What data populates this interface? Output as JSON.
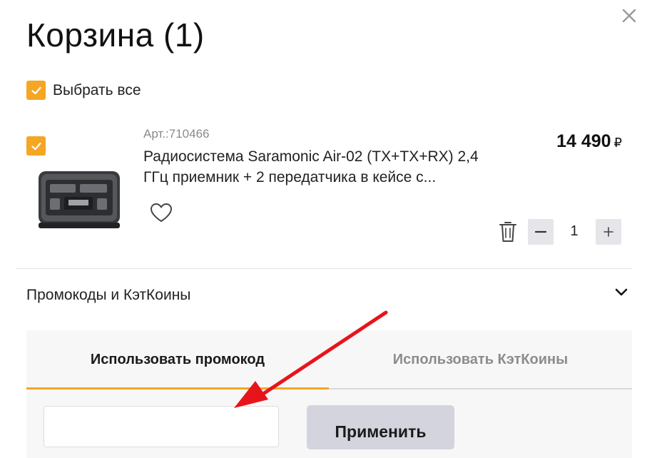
{
  "cart": {
    "title": "Корзина (1)",
    "select_all_label": "Выбрать все",
    "close_icon": "close-icon"
  },
  "item": {
    "article": "Арт.:710466",
    "name": "Радиосистема Saramonic Air-02 (TX+TX+RX) 2,4 ГГц приемник + 2 передатчика в кейсе с...",
    "price": "14 490",
    "currency": "₽",
    "quantity": "1",
    "selected": true
  },
  "promo": {
    "header": "Промокоды и КэтКоины",
    "tabs": [
      {
        "label": "Использовать  промокод",
        "active": true
      },
      {
        "label": "Использовать  КэтКоины",
        "active": false
      }
    ],
    "input_value": "",
    "apply_label": "Применить"
  },
  "colors": {
    "accent": "#f5a623",
    "button_gray": "#d4d4de",
    "annotation_arrow": "#e8141b"
  }
}
